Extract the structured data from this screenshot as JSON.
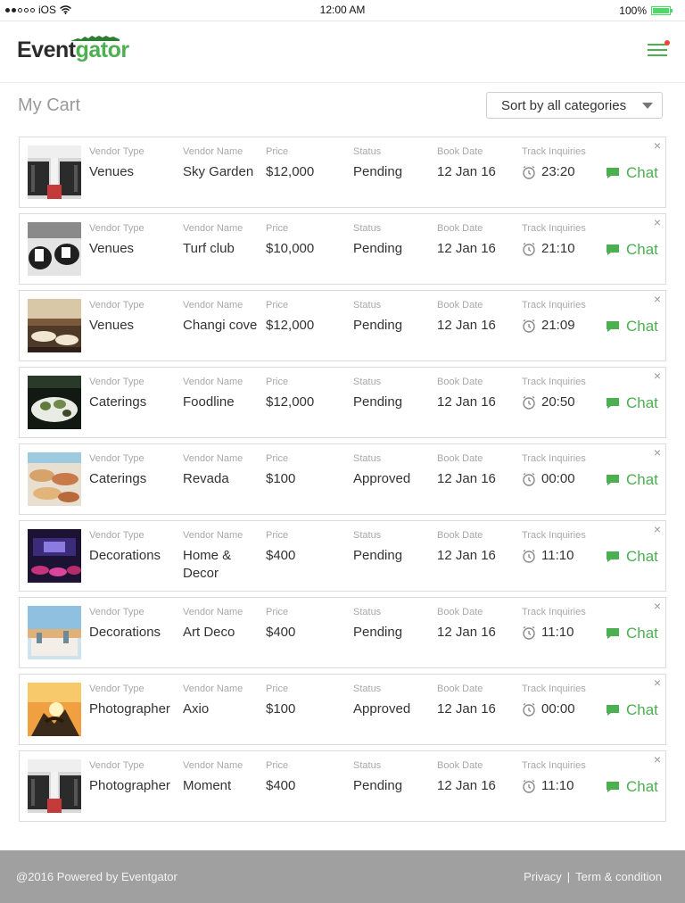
{
  "status_bar": {
    "carrier": "iOS",
    "time": "12:00 AM",
    "battery": "100%"
  },
  "header": {
    "logo_part1": "Event",
    "logo_part2": "gator"
  },
  "page": {
    "title": "My Cart",
    "sort_label": "Sort by all categories"
  },
  "labels": {
    "vendor_type": "Vendor Type",
    "vendor_name": "Vendor Name",
    "price": "Price",
    "status": "Status",
    "book_date": "Book Date",
    "track": "Track Inquiries",
    "chat": "Chat",
    "close": "×"
  },
  "cart": [
    {
      "type": "Venues",
      "name": "Sky Garden",
      "price": "$12,000",
      "status": "Pending",
      "date": "12 Jan 16",
      "timer": "23:20",
      "thumb": "venue"
    },
    {
      "type": "Venues",
      "name": "Turf club",
      "price": "$10,000",
      "status": "Pending",
      "date": "12 Jan 16",
      "timer": "21:10",
      "thumb": "venue2"
    },
    {
      "type": "Venues",
      "name": "Changi cove",
      "price": "$12,000",
      "status": "Pending",
      "date": "12 Jan 16",
      "timer": "21:09",
      "thumb": "venue3"
    },
    {
      "type": "Caterings",
      "name": "Foodline",
      "price": "$12,000",
      "status": "Pending",
      "date": "12 Jan 16",
      "timer": "20:50",
      "thumb": "food"
    },
    {
      "type": "Caterings",
      "name": "Revada",
      "price": "$100",
      "status": "Approved",
      "date": "12 Jan 16",
      "timer": "00:00",
      "thumb": "food2"
    },
    {
      "type": "Decorations",
      "name": "Home & Decor",
      "price": "$400",
      "status": "Pending",
      "date": "12 Jan 16",
      "timer": "11:10",
      "thumb": "deco"
    },
    {
      "type": "Decorations",
      "name": "Art Deco",
      "price": "$400",
      "status": "Pending",
      "date": "12 Jan 16",
      "timer": "11:10",
      "thumb": "deco2"
    },
    {
      "type": "Photographer",
      "name": "Axio",
      "price": "$100",
      "status": "Approved",
      "date": "12 Jan 16",
      "timer": "00:00",
      "thumb": "photo"
    },
    {
      "type": "Photographer",
      "name": "Moment",
      "price": "$400",
      "status": "Pending",
      "date": "12 Jan 16",
      "timer": "11:10",
      "thumb": "venue"
    }
  ],
  "footer": {
    "copyright": "@2016 Powered by Eventgator",
    "privacy": "Privacy",
    "separator": "|",
    "terms": "Term & condition"
  },
  "colors": {
    "accent": "#4caf50",
    "footer_bg": "#a0a0a0",
    "notification": "#f44336"
  }
}
